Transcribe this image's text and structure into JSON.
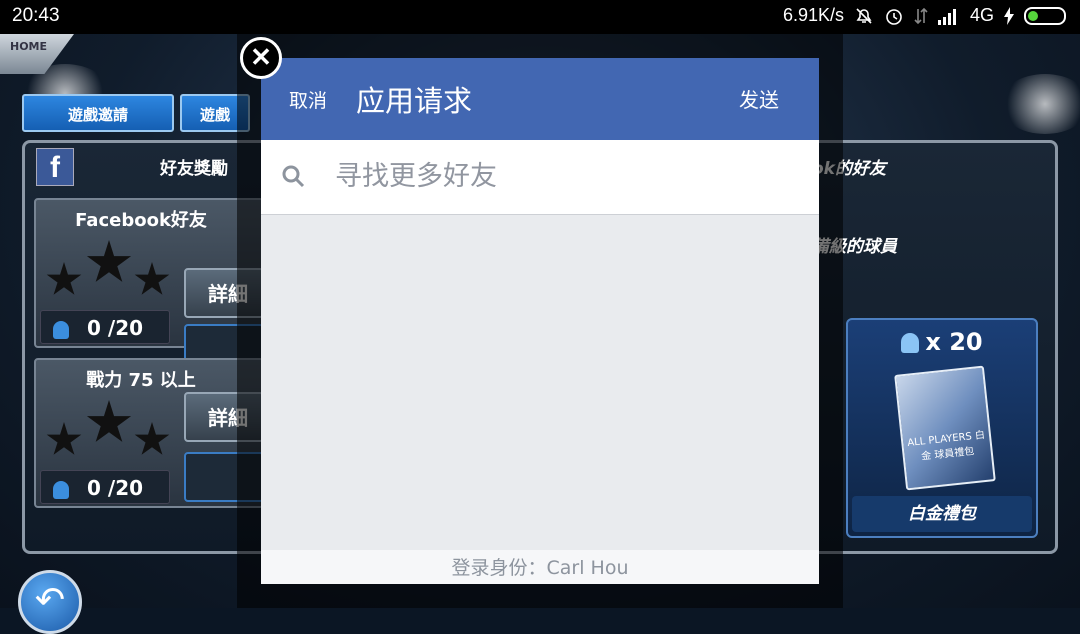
{
  "status_bar": {
    "time": "20:43",
    "network_speed": "6.91K/s",
    "network_type": "4G",
    "icons": [
      "mute-icon",
      "alarm-icon",
      "data-icon",
      "signal-icon",
      "charging-icon",
      "battery-icon"
    ]
  },
  "game": {
    "home_label": "HOME",
    "tabs": [
      "遊戲邀請",
      "遊戲"
    ],
    "reward_title": "好友獎勵",
    "fb_letter": "f",
    "cards": [
      {
        "title": "Facebook好友",
        "count": "0",
        "total": "/20",
        "detail_label": "詳細內"
      },
      {
        "title": "戰力 75 以上",
        "count": "0",
        "total": "/20",
        "detail_label": "詳細內"
      }
    ],
    "right_labels": [
      "ok的好友",
      "備級的球員"
    ],
    "prize": {
      "count_label": "x 20",
      "pack_text": "ALL PLAYERS 白金 球員禮包",
      "label": "白金禮包"
    }
  },
  "dialog": {
    "cancel_label": "取消",
    "title": "应用请求",
    "send_label": "发送",
    "search_placeholder": "寻找更多好友",
    "footer_text": "登录身份：Carl Hou",
    "header_color": "#4267b2"
  }
}
